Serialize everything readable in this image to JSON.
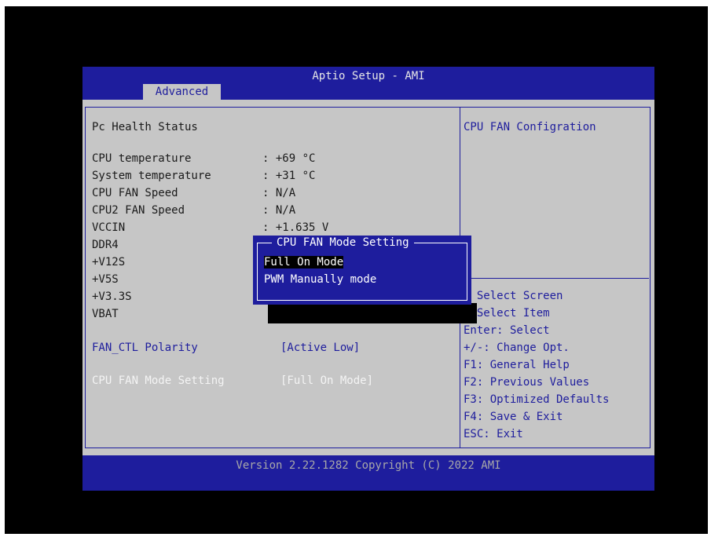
{
  "header": {
    "title": "Aptio Setup - AMI",
    "tab": "Advanced"
  },
  "main": {
    "section_title": "Pc Health Status",
    "rows": [
      {
        "label": "CPU temperature",
        "value": ": +69 °C"
      },
      {
        "label": "System temperature",
        "value": ": +31 °C"
      },
      {
        "label": "CPU FAN Speed",
        "value": ": N/A"
      },
      {
        "label": "CPU2 FAN Speed",
        "value": ": N/A"
      },
      {
        "label": "VCCIN",
        "value": ": +1.635 V"
      },
      {
        "label": "DDR4",
        "value": ""
      },
      {
        "label": "+V12S",
        "value": ""
      },
      {
        "label": "+V5S",
        "value": ""
      },
      {
        "label": "+V3.3S",
        "value": ""
      },
      {
        "label": "VBAT",
        "value": ""
      }
    ],
    "fan_ctl": {
      "label": "FAN_CTL Polarity",
      "value": "[Active Low]"
    },
    "cpu_fan_mode": {
      "label": "CPU FAN Mode Setting",
      "value": "[Full On Mode]"
    }
  },
  "help": {
    "description": "CPU FAN Configration",
    "keys": [
      "  Select Screen",
      "  Select Item",
      "Enter: Select",
      "+/-: Change Opt.",
      "F1: General Help",
      "F2: Previous Values",
      "F3: Optimized Defaults",
      "F4: Save & Exit",
      "ESC: Exit"
    ]
  },
  "popup": {
    "title": "CPU FAN Mode Setting",
    "options": [
      "Full On Mode",
      "PWM Manually mode"
    ],
    "selected_index": 0
  },
  "footer": {
    "version": "Version 2.22.1282 Copyright (C) 2022 AMI"
  },
  "colors": {
    "bios_blue": "#1e1d9d",
    "panel_gray": "#c6c6c6",
    "text_dark": "#1a1a1a",
    "highlight": "#000000"
  }
}
